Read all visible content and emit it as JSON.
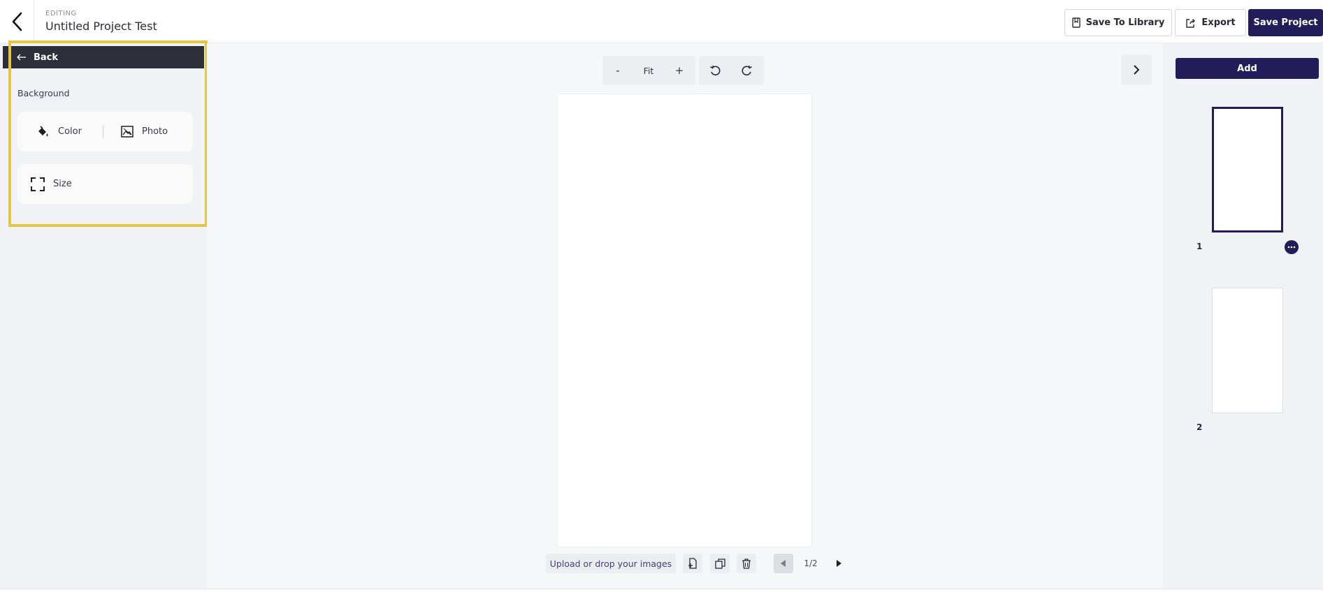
{
  "header": {
    "editing_label": "EDITING",
    "project_title": "Untitled Project Test",
    "save_library_label": "Save To Library",
    "export_label": "Export",
    "save_project_label": "Save Project"
  },
  "left_panel": {
    "back_label": "Back",
    "section_label": "Background",
    "color_label": "Color",
    "photo_label": "Photo",
    "size_label": "Size",
    "highlight_color": "#e4c640"
  },
  "canvas": {
    "zoom_out_label": "-",
    "zoom_fit_label": "Fit",
    "zoom_in_label": "+",
    "upload_label": "Upload or drop your images",
    "page_indicator": "1/2"
  },
  "pages_panel": {
    "add_label": "Add",
    "pages": [
      {
        "number": "1",
        "selected": true
      },
      {
        "number": "2",
        "selected": false
      }
    ]
  },
  "colors": {
    "brand": "#221d58",
    "panel_bg": "#f1f2f5",
    "canvas_bg": "#f6f7f9",
    "dark_header": "#2c2f38"
  },
  "icons": {
    "back": "chevron-left-icon",
    "library": "bookmark-icon",
    "export": "share-icon",
    "paint_bucket": "paint-bucket-icon",
    "photo": "image-icon",
    "size": "resize-frame-icon",
    "undo": "rotate-left-icon",
    "redo": "rotate-right-icon",
    "next": "chevron-right-icon",
    "add_page": "add-page-icon",
    "duplicate": "duplicate-icon",
    "delete": "trash-icon",
    "more": "more-dots-icon"
  }
}
